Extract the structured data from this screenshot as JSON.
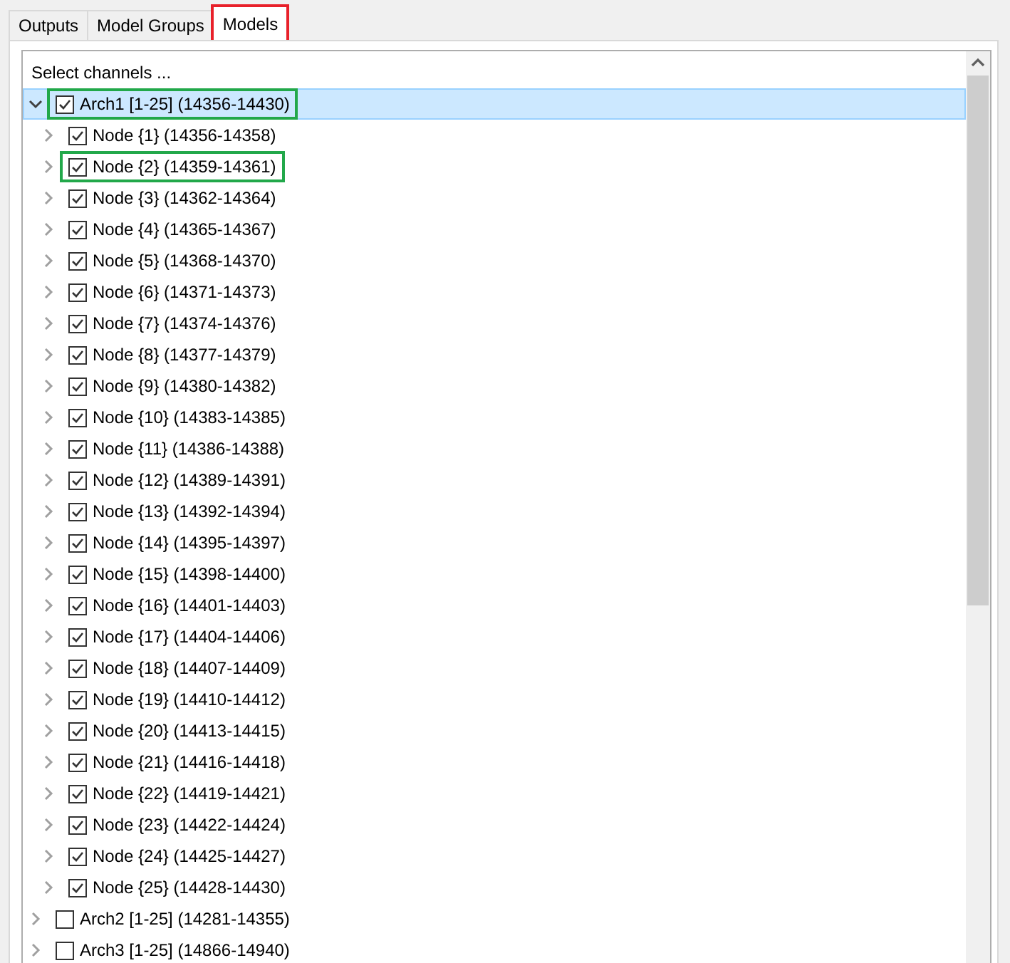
{
  "tabs": [
    {
      "label": "Outputs",
      "selected": false,
      "highlighted": false
    },
    {
      "label": "Model Groups",
      "selected": false,
      "highlighted": false
    },
    {
      "label": "Models",
      "selected": true,
      "highlighted": true
    }
  ],
  "tree": {
    "header": "Select channels ...",
    "items": [
      {
        "label": "Arch1 [1-25] (14356-14430)",
        "checked": true,
        "expanded": true,
        "selected": true,
        "highlighted": true,
        "children": [
          {
            "label": "Node {1} (14356-14358)",
            "checked": true,
            "expanded": false,
            "selected": false,
            "highlighted": false
          },
          {
            "label": "Node {2} (14359-14361)",
            "checked": true,
            "expanded": false,
            "selected": false,
            "highlighted": true
          },
          {
            "label": "Node {3} (14362-14364)",
            "checked": true,
            "expanded": false,
            "selected": false,
            "highlighted": false
          },
          {
            "label": "Node {4} (14365-14367)",
            "checked": true,
            "expanded": false,
            "selected": false,
            "highlighted": false
          },
          {
            "label": "Node {5} (14368-14370)",
            "checked": true,
            "expanded": false,
            "selected": false,
            "highlighted": false
          },
          {
            "label": "Node {6} (14371-14373)",
            "checked": true,
            "expanded": false,
            "selected": false,
            "highlighted": false
          },
          {
            "label": "Node {7} (14374-14376)",
            "checked": true,
            "expanded": false,
            "selected": false,
            "highlighted": false
          },
          {
            "label": "Node {8} (14377-14379)",
            "checked": true,
            "expanded": false,
            "selected": false,
            "highlighted": false
          },
          {
            "label": "Node {9} (14380-14382)",
            "checked": true,
            "expanded": false,
            "selected": false,
            "highlighted": false
          },
          {
            "label": "Node {10} (14383-14385)",
            "checked": true,
            "expanded": false,
            "selected": false,
            "highlighted": false
          },
          {
            "label": "Node {11} (14386-14388)",
            "checked": true,
            "expanded": false,
            "selected": false,
            "highlighted": false
          },
          {
            "label": "Node {12} (14389-14391)",
            "checked": true,
            "expanded": false,
            "selected": false,
            "highlighted": false
          },
          {
            "label": "Node {13} (14392-14394)",
            "checked": true,
            "expanded": false,
            "selected": false,
            "highlighted": false
          },
          {
            "label": "Node {14} (14395-14397)",
            "checked": true,
            "expanded": false,
            "selected": false,
            "highlighted": false
          },
          {
            "label": "Node {15} (14398-14400)",
            "checked": true,
            "expanded": false,
            "selected": false,
            "highlighted": false
          },
          {
            "label": "Node {16} (14401-14403)",
            "checked": true,
            "expanded": false,
            "selected": false,
            "highlighted": false
          },
          {
            "label": "Node {17} (14404-14406)",
            "checked": true,
            "expanded": false,
            "selected": false,
            "highlighted": false
          },
          {
            "label": "Node {18} (14407-14409)",
            "checked": true,
            "expanded": false,
            "selected": false,
            "highlighted": false
          },
          {
            "label": "Node {19} (14410-14412)",
            "checked": true,
            "expanded": false,
            "selected": false,
            "highlighted": false
          },
          {
            "label": "Node {20} (14413-14415)",
            "checked": true,
            "expanded": false,
            "selected": false,
            "highlighted": false
          },
          {
            "label": "Node {21} (14416-14418)",
            "checked": true,
            "expanded": false,
            "selected": false,
            "highlighted": false
          },
          {
            "label": "Node {22} (14419-14421)",
            "checked": true,
            "expanded": false,
            "selected": false,
            "highlighted": false
          },
          {
            "label": "Node {23} (14422-14424)",
            "checked": true,
            "expanded": false,
            "selected": false,
            "highlighted": false
          },
          {
            "label": "Node {24} (14425-14427)",
            "checked": true,
            "expanded": false,
            "selected": false,
            "highlighted": false
          },
          {
            "label": "Node {25} (14428-14430)",
            "checked": true,
            "expanded": false,
            "selected": false,
            "highlighted": false
          }
        ]
      },
      {
        "label": "Arch2 [1-25] (14281-14355)",
        "checked": false,
        "expanded": false,
        "selected": false,
        "highlighted": false
      },
      {
        "label": "Arch3 [1-25] (14866-14940)",
        "checked": false,
        "expanded": false,
        "selected": false,
        "highlighted": false
      }
    ]
  }
}
